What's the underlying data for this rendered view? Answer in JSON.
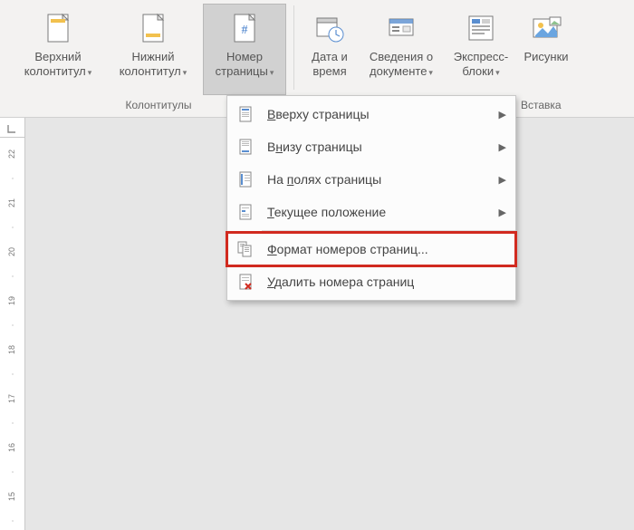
{
  "ribbon": {
    "buttons": {
      "header": {
        "line1": "Верхний",
        "line2": "колонтитул"
      },
      "footer": {
        "line1": "Нижний",
        "line2": "колонтитул"
      },
      "pagenum": {
        "line1": "Номер",
        "line2": "страницы"
      },
      "datetime": {
        "line1": "Дата и",
        "line2": "время"
      },
      "docinfo": {
        "line1": "Сведения о",
        "line2": "документе"
      },
      "quickparts": {
        "line1": "Экспресс-",
        "line2": "блоки"
      },
      "pictures": {
        "line1": "Рисунки",
        "line2": ""
      }
    },
    "groups": {
      "headers": "Колонтитулы",
      "insert": "Вставка"
    }
  },
  "menu": {
    "top": "Вверху страницы",
    "bottom": "Внизу страницы",
    "margins": "На полях страницы",
    "current": "Текущее положение",
    "format": "Формат номеров страниц...",
    "remove": "Удалить номера страниц",
    "accel": {
      "top": "В",
      "bottom": "н",
      "margins": "п",
      "current": "Т",
      "format": "Ф",
      "remove": "У"
    }
  },
  "ruler": {
    "marks": [
      22,
      21,
      20,
      19,
      18,
      17,
      16,
      15
    ]
  }
}
